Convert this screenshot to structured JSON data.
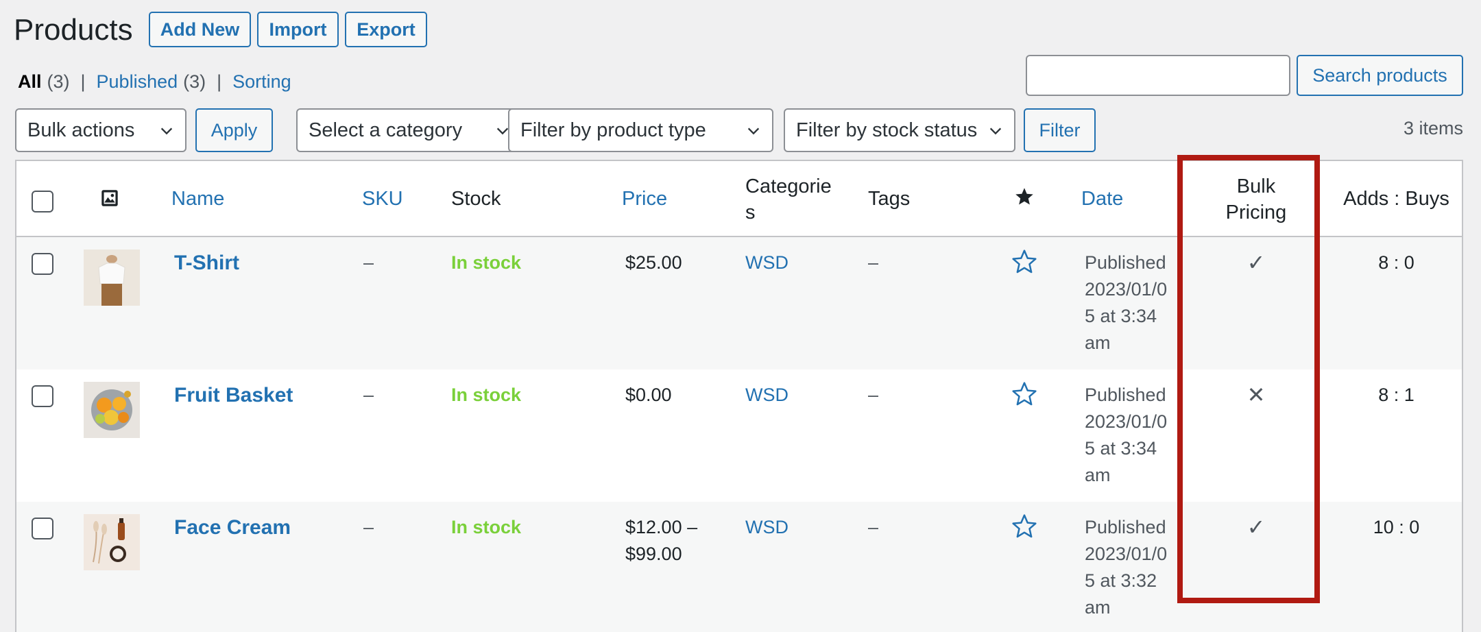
{
  "header": {
    "title": "Products",
    "add_new": "Add New",
    "import": "Import",
    "export": "Export"
  },
  "views": [
    {
      "label": "All",
      "count": "(3)"
    },
    {
      "label": "Published",
      "count": "(3)"
    },
    {
      "label": "Sorting"
    }
  ],
  "views_sep": "|",
  "search": {
    "value": "",
    "button": "Search products"
  },
  "toolbar": {
    "bulk_actions": "Bulk actions",
    "apply": "Apply",
    "category": "Select a category",
    "product_type": "Filter by product type",
    "stock_status": "Filter by stock status",
    "filter": "Filter",
    "items_count": "3 items"
  },
  "columns": {
    "thumb_icon": "image-icon",
    "name": "Name",
    "sku": "SKU",
    "stock": "Stock",
    "price": "Price",
    "categories_1": "Categorie",
    "categories_2": "s",
    "tags": "Tags",
    "featured_icon": "star-filled-icon",
    "date": "Date",
    "bulk_pricing_1": "Bulk",
    "bulk_pricing_2": "Pricing",
    "adds_buys": "Adds : Buys"
  },
  "rows": [
    {
      "name": "T-Shirt",
      "sku": "–",
      "stock": "In stock",
      "price_1": "$25.00",
      "price_2": "",
      "category": "WSD",
      "tags": "–",
      "date_1": "Published",
      "date_2": "2023/01/0",
      "date_3": "5 at 3:34",
      "date_4": "am",
      "bulk_pricing": "✓",
      "bulk_pricing_icon": "checkmark-icon",
      "adds_buys": "8 : 0"
    },
    {
      "name": "Fruit Basket",
      "sku": "–",
      "stock": "In stock",
      "price_1": "$0.00",
      "price_2": "",
      "category": "WSD",
      "tags": "–",
      "date_1": "Published",
      "date_2": "2023/01/0",
      "date_3": "5 at 3:34",
      "date_4": "am",
      "bulk_pricing": "✕",
      "bulk_pricing_icon": "cross-icon",
      "adds_buys": "8 : 1"
    },
    {
      "name": "Face Cream",
      "sku": "–",
      "stock": "In stock",
      "price_1": "$12.00 –",
      "price_2": "$99.00",
      "category": "WSD",
      "tags": "–",
      "date_1": "Published",
      "date_2": "2023/01/0",
      "date_3": "5 at 3:32",
      "date_4": "am",
      "bulk_pricing": "✓",
      "bulk_pricing_icon": "checkmark-icon",
      "adds_buys": "10 : 0"
    }
  ],
  "colors": {
    "link": "#2271b1",
    "in_stock": "#7ad03a",
    "highlight": "#b01a12",
    "background": "#f0f0f1"
  }
}
